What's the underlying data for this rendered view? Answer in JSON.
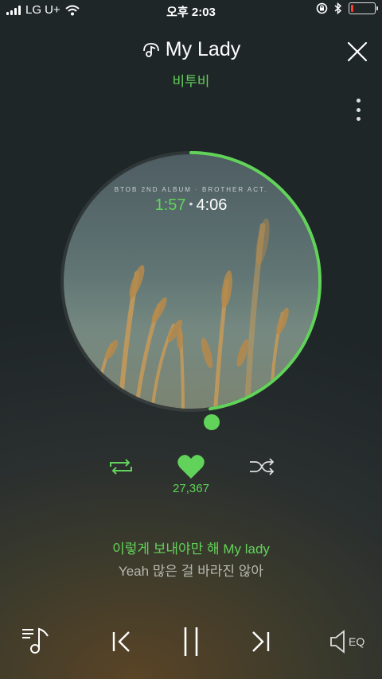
{
  "status_bar": {
    "carrier": "LG U+",
    "time": "오후 2:03",
    "battery_level": 0.12
  },
  "header": {
    "song_title": "My Lady",
    "artist": "비투비",
    "icons": [
      "music-note-icon",
      "close-icon",
      "more-vertical-icon"
    ]
  },
  "player": {
    "album_caption": "BTOB 2ND ALBUM · BROTHER ACT.",
    "current_time": "1:57",
    "total_time": "4:06",
    "progress": 0.476,
    "accent_color": "#62d35a"
  },
  "controls": {
    "likes_count": "27,367",
    "icons": [
      "repeat-icon",
      "heart-icon",
      "shuffle-icon"
    ]
  },
  "lyrics": {
    "current_line": "이렇게 보내야만 해 My lady",
    "next_line": "Yeah 많은 걸 바라진 않아"
  },
  "bottom_bar": {
    "eq_label": "EQ",
    "icons": [
      "playlist-icon",
      "previous-icon",
      "pause-icon",
      "next-icon",
      "eq-icon"
    ]
  }
}
